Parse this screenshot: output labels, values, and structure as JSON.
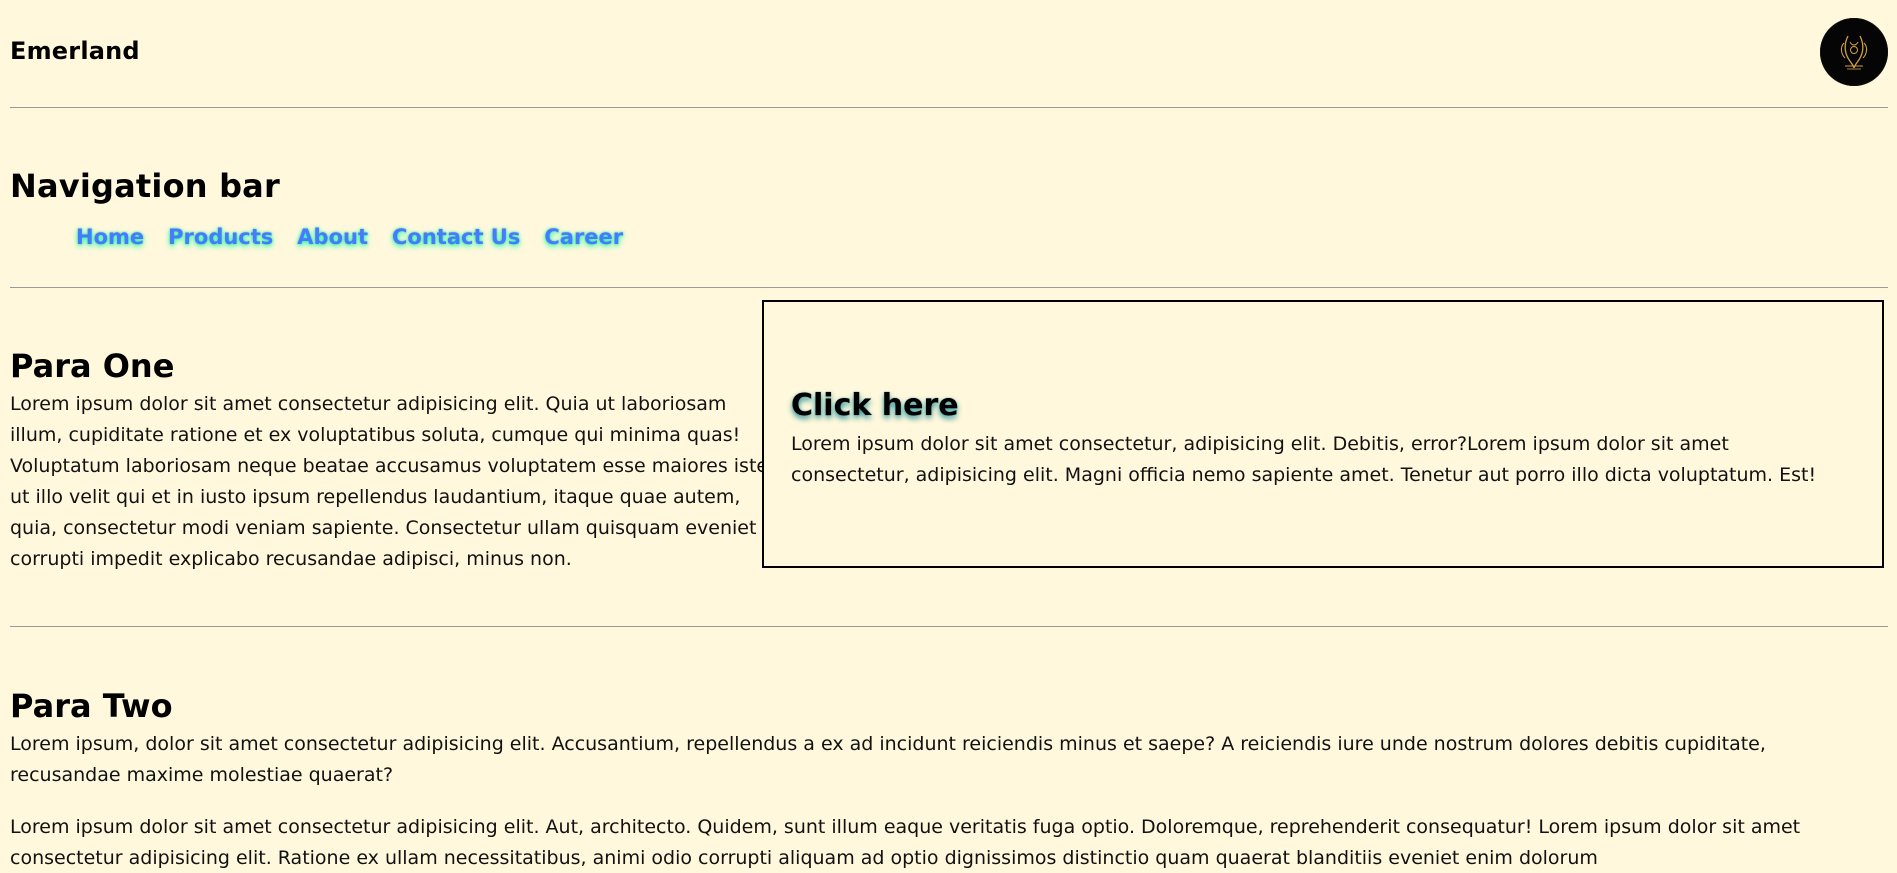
{
  "header": {
    "brand": "Emerland"
  },
  "navigation": {
    "title": "Navigation bar",
    "links": [
      {
        "label": "Home"
      },
      {
        "label": "Products"
      },
      {
        "label": "About"
      },
      {
        "label": "Contact Us"
      },
      {
        "label": "Career"
      }
    ]
  },
  "para_one": {
    "title": "Para One",
    "text": "Lorem ipsum dolor sit amet consectetur adipisicing elit. Quia ut laboriosam illum, cupiditate ratione et ex voluptatibus soluta, cumque qui minima quas! Voluptatum laboriosam neque beatae accusamus voluptatem esse maiores iste ut illo velit qui et in iusto ipsum repellendus laudantium, itaque quae autem, quia, consectetur modi veniam sapiente. Consectetur ullam quisquam eveniet corrupti impedit explicabo recusandae adipisci, minus non."
  },
  "click_box": {
    "title": "Click here",
    "text": "Lorem ipsum dolor sit amet consectetur, adipisicing elit. Debitis, error?Lorem ipsum dolor sit amet consectetur, adipisicing elit. Magni officia nemo sapiente amet. Tenetur aut porro illo dicta voluptatum. Est!"
  },
  "para_two": {
    "title": "Para Two",
    "text_1": "Lorem ipsum, dolor sit amet consectetur adipisicing elit. Accusantium, repellendus a ex ad incidunt reiciendis minus et saepe? A reiciendis iure unde nostrum dolores debitis cupiditate, recusandae maxime molestiae quaerat?",
    "text_2": "Lorem ipsum dolor sit amet consectetur adipisicing elit. Aut, architecto. Quidem, sunt illum eaque veritatis fuga optio. Doloremque, reprehenderit consequatur! Lorem ipsum dolor sit amet consectetur adipisicing elit. Ratione ex ullam necessitatibus, animi odio corrupti aliquam ad optio dignissimos distinctio quam quaerat blanditiis eveniet enim dolorum"
  },
  "icons": {
    "logo": "logo-icon"
  },
  "colors": {
    "background": "#fff8dc",
    "nav_link": "#4a78ff",
    "nav_glow": "#00ffa0",
    "click_shadow": "#1b8d97",
    "logo_gold": "#d2a03c"
  }
}
